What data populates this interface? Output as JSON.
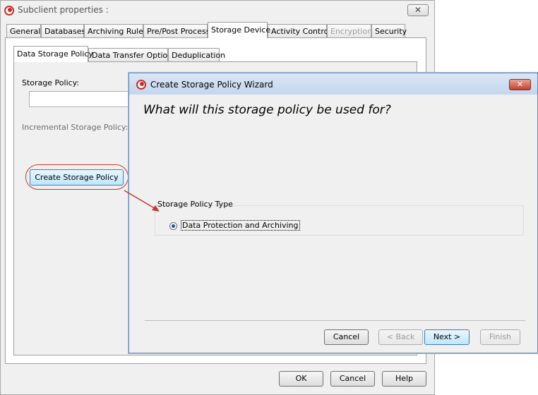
{
  "back_window": {
    "title": "Subclient properties :",
    "close_glyph": "✕",
    "tabs": [
      {
        "label": "General"
      },
      {
        "label": "Databases"
      },
      {
        "label": "Archiving Rules"
      },
      {
        "label": "Pre/Post Process"
      },
      {
        "label": "Storage Device"
      },
      {
        "label": "Activity Control"
      },
      {
        "label": "Encryption"
      },
      {
        "label": "Security"
      }
    ],
    "active_tab": "Storage Device",
    "subtabs": [
      {
        "label": "Data Storage Policy"
      },
      {
        "label": "Data Transfer Option"
      },
      {
        "label": "Deduplication"
      }
    ],
    "storage_policy_label": "Storage Policy:",
    "storage_policy_value": "",
    "incremental_label": "Incremental Storage Policy:",
    "create_button": "Create Storage Policy",
    "buttons": {
      "ok": "OK",
      "cancel": "Cancel",
      "help": "Help"
    }
  },
  "wizard": {
    "title": "Create Storage Policy Wizard",
    "close_glyph": "✕",
    "heading": "What will this storage policy be used for?",
    "group_label": "Storage Policy Type",
    "option_label": "Data Protection and Archiving",
    "option_selected": true,
    "buttons": {
      "cancel": "Cancel",
      "back": "< Back",
      "next": "Next >",
      "finish": "Finish"
    }
  },
  "annotation": {
    "color": "#c0392b",
    "icon": "callout-arrow"
  },
  "colors": {
    "accent": "#3c7fb1",
    "highlight": "#c0392b"
  }
}
